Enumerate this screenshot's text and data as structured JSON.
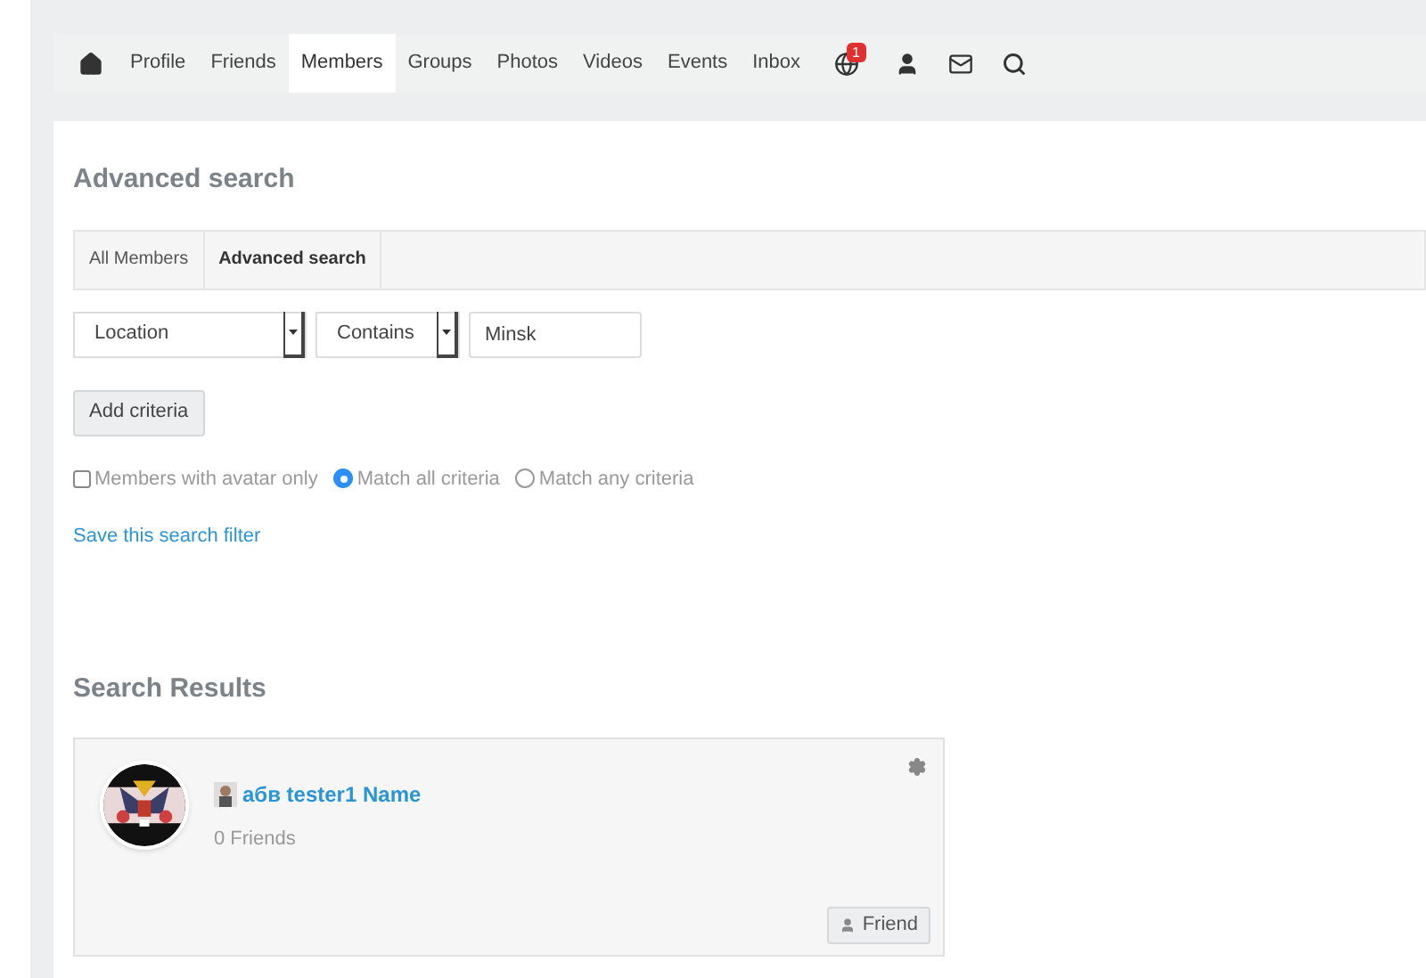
{
  "nav": {
    "links": [
      {
        "label": "Profile",
        "selected": false
      },
      {
        "label": "Friends",
        "selected": false
      },
      {
        "label": "Members",
        "selected": true
      },
      {
        "label": "Groups",
        "selected": false
      },
      {
        "label": "Photos",
        "selected": false
      },
      {
        "label": "Videos",
        "selected": false
      },
      {
        "label": "Events",
        "selected": false
      },
      {
        "label": "Inbox",
        "selected": false
      }
    ],
    "notification_badge": "1"
  },
  "page_title": "Advanced search",
  "tabs": [
    {
      "label": "All Members",
      "selected": false
    },
    {
      "label": "Advanced search",
      "selected": true
    }
  ],
  "criteria": {
    "field": "Location",
    "operator": "Contains",
    "value": "Minsk"
  },
  "add_button": "Add criteria",
  "options": [
    {
      "kind": "checkbox",
      "label": "Members with avatar only",
      "checked": false
    },
    {
      "kind": "radio",
      "label": "Match all criteria",
      "selected": true
    },
    {
      "kind": "radio",
      "label": "Match any criteria",
      "selected": false
    }
  ],
  "save_link": "Save this search filter",
  "results_title": "Search Results",
  "results": [
    {
      "name": "абв tester1 Name",
      "friends": "0 Friends",
      "action": "Friend"
    }
  ]
}
